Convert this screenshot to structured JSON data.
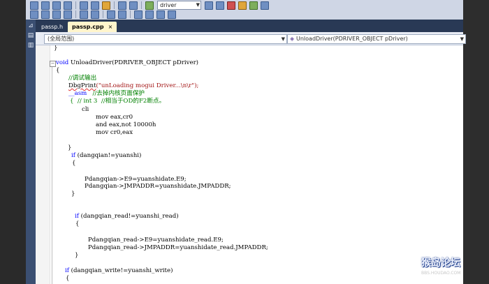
{
  "toolbar": {
    "config_value": "driver"
  },
  "side_strip": {
    "icons": [
      "pin-icon",
      "server-explorer-icon"
    ]
  },
  "tabs": [
    {
      "label": "passp.h",
      "active": false
    },
    {
      "label": "passp.cpp",
      "active": true,
      "close": "×"
    }
  ],
  "nav": {
    "scope_value": "(全局范围)",
    "member_value": "UnloadDriver(PDRIVER_OBJECT pDriver)"
  },
  "code_lines": [
    {
      "id": 0,
      "text": "}"
    },
    {
      "id": 1,
      "pre": "void ",
      "text": "UnloadDriver(PDRIVER_OBJECT pDriver)"
    },
    {
      "id": 2,
      "text": "{"
    },
    {
      "id": 3,
      "text": "//调试输出"
    },
    {
      "id": 4,
      "pre": "DbgPrint",
      "text": "(\"unLoading mogui Driver...\\n\\r\");"
    },
    {
      "id": 5,
      "pre": "__asm",
      "text": "   //去掉内核页面保护"
    },
    {
      "id": 6,
      "text": "{  // int 3  //相当于OD的F2断点。"
    },
    {
      "id": 7,
      "text": "cli"
    },
    {
      "id": 8,
      "text": "mov eax,cr0"
    },
    {
      "id": 9,
      "text": "and eax,not 10000h"
    },
    {
      "id": 10,
      "text": "mov cr0,eax"
    },
    {
      "id": 11,
      "text": "}"
    },
    {
      "id": 12,
      "pre": "if ",
      "text": "(dangqian!=yuanshi)"
    },
    {
      "id": 13,
      "text": "{"
    },
    {
      "id": 14,
      "text": "Pdangqian->E9=yuanshidate.E9;"
    },
    {
      "id": 15,
      "text": "Pdangqian->JMPADDR=yuanshidate.JMPADDR;"
    },
    {
      "id": 16,
      "text": "}"
    },
    {
      "id": 17,
      "pre": "if ",
      "text": "(dangqian_read!=yuanshi_read)"
    },
    {
      "id": 18,
      "text": "{"
    },
    {
      "id": 19,
      "text": "Pdangqian_read->E9=yuanshidate_read.E9;"
    },
    {
      "id": 20,
      "text": "Pdangqian_read->JMPADDR=yuanshidate_read.JMPADDR;"
    },
    {
      "id": 21,
      "text": "}"
    },
    {
      "id": 22,
      "pre": "if ",
      "text": "(dangqian_write!=yuanshi_write)"
    },
    {
      "id": 23,
      "text": "{"
    }
  ],
  "watermark": {
    "title": "猴岛论坛",
    "subtitle": "BBS.HOUDAO.COM"
  },
  "colors": {
    "keyword": "#0000ff",
    "comment": "#008000",
    "string": "#a31515",
    "tab_bar": "#293955",
    "active_tab": "#fff5cc"
  }
}
